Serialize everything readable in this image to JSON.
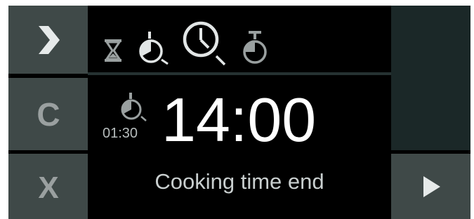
{
  "colors": {
    "button_bg": "#3f4948",
    "side_panel_bg": "#1b2828",
    "screen_bg": "#000000",
    "icon_active": "#e2e6e6",
    "icon_inactive": "#9aa0a0",
    "text_primary": "#ffffff",
    "text_secondary": "#c9cfcf"
  },
  "buttons": {
    "next": {
      "icon": "chevron-right-icon"
    },
    "clear": {
      "label": "C",
      "icon": "clear-icon"
    },
    "cancel": {
      "label": "X",
      "icon": "cancel-icon"
    },
    "play": {
      "icon": "play-icon"
    }
  },
  "mode_icons": [
    {
      "name": "hourglass-icon",
      "active": false
    },
    {
      "name": "duration-timer-icon",
      "active": false
    },
    {
      "name": "end-time-clock-icon",
      "active": true
    },
    {
      "name": "start-time-timer-icon",
      "active": false
    }
  ],
  "display": {
    "duration": "01:30",
    "time": "14:00",
    "status": "Cooking time end"
  }
}
